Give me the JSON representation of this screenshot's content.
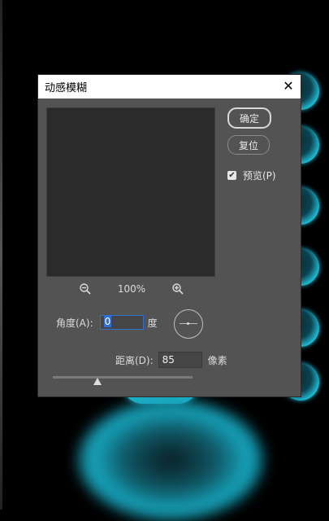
{
  "dialog": {
    "title": "动感模糊",
    "close_glyph": "✕",
    "ok_label": "确定",
    "reset_label": "复位",
    "preview_label": "预览(P)",
    "preview_checked": true,
    "zoom_level": "100%",
    "angle_label": "角度(A):",
    "angle_value": "0",
    "angle_unit": "度",
    "distance_label": "距离(D):",
    "distance_value": "85",
    "distance_unit": "像素"
  },
  "icons": {
    "zoom_out": "zoom-out-icon",
    "zoom_in": "zoom-in-icon",
    "close": "close-icon",
    "check": "check-icon"
  },
  "colors": {
    "dialog_bg": "#535353",
    "accent_cyan": "#1fb7cf",
    "focus_blue": "#2f6fd6"
  }
}
